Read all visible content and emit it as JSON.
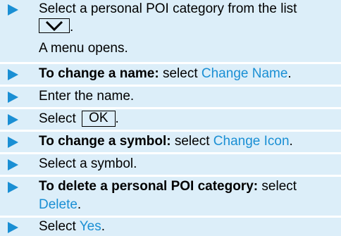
{
  "steps": [
    {
      "line1": "Select a personal POI category from the list",
      "line2_suffix": ".",
      "result": "A menu opens.",
      "key_icon": "chevron-down-icon"
    },
    {
      "bold": "To change a name:",
      "plain": " select ",
      "link": "Change Name",
      "end": "."
    },
    {
      "plain": "Enter the name."
    },
    {
      "pre": "Select ",
      "key": "OK",
      "end": "."
    },
    {
      "bold": "To change a symbol:",
      "plain": " select ",
      "link": "Change Icon",
      "end": "."
    },
    {
      "plain": "Select a symbol."
    },
    {
      "bold": "To delete a personal POI category:",
      "plain": " select",
      "link": "Delete",
      "end": "."
    },
    {
      "pre": "Select ",
      "link": "Yes",
      "end": "."
    }
  ],
  "colors": {
    "band": "#dceef9",
    "arrow": "#1a8fd4",
    "link": "#1a8fd4"
  }
}
